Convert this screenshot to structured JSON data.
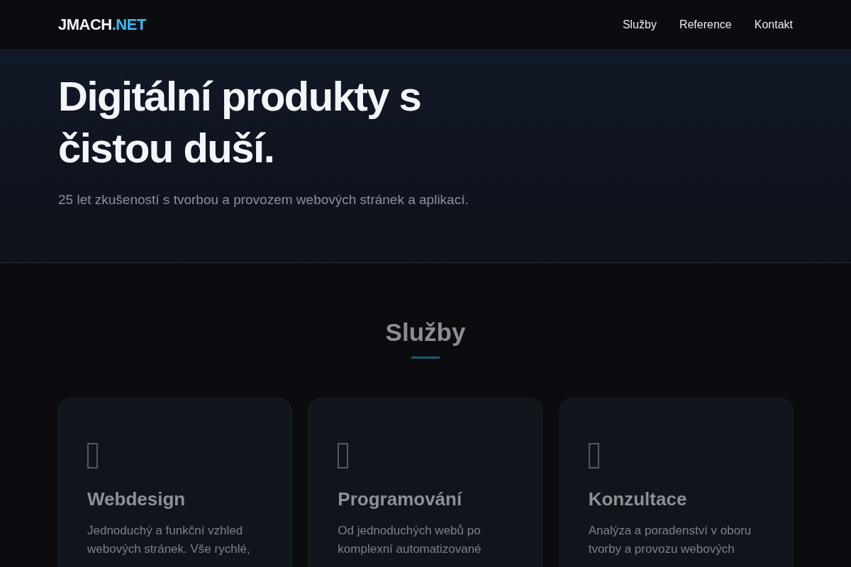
{
  "header": {
    "logo": {
      "name": "JMACH",
      "suffix": ".NET"
    },
    "nav": [
      {
        "label": "Služby"
      },
      {
        "label": "Reference"
      },
      {
        "label": "Kontakt"
      }
    ]
  },
  "hero": {
    "title": "Digitální produkty s čistou duší.",
    "subtitle": "25 let zkušeností s tvorbou a provozem webových stránek a aplikací."
  },
  "services": {
    "title": "Služby",
    "cards": [
      {
        "title": "Webdesign",
        "text": "Jednoduchý a funkční vzhled webových stránek. Vše rychlé,"
      },
      {
        "title": "Programování",
        "text": "Od jednoduchých webů po komplexní automatizované"
      },
      {
        "title": "Konzultace",
        "text": "Analýza a poradenství v oboru tvorby a provozu webových"
      }
    ]
  }
}
